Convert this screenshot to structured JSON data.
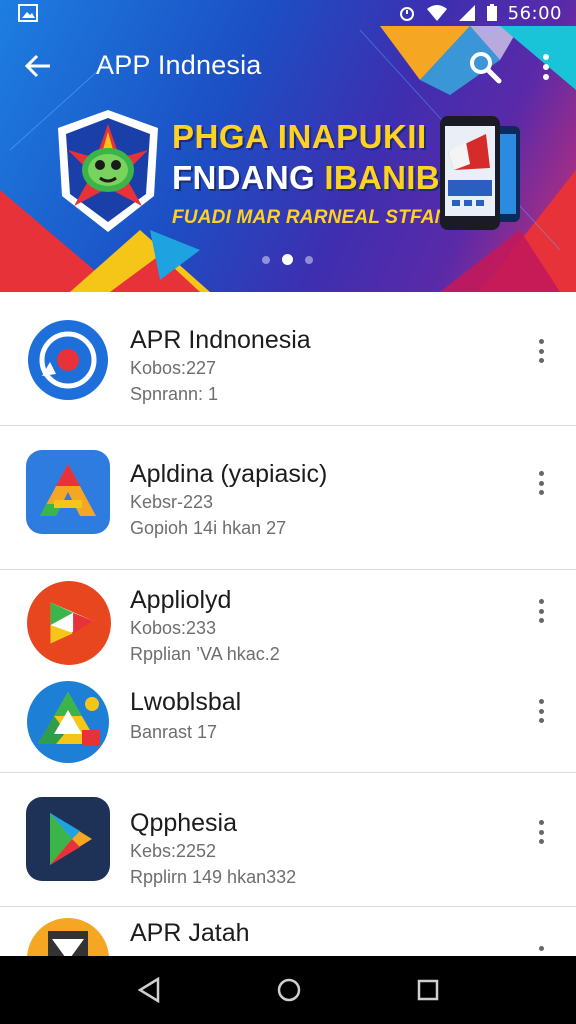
{
  "status_bar": {
    "time": "56:00",
    "icons": [
      "image-icon",
      "alarm-icon",
      "wifi-icon",
      "signal-icon",
      "battery-icon"
    ]
  },
  "app_bar": {
    "title": "APP Indnesia",
    "icons": [
      "back-arrow-icon",
      "search-icon",
      "more-vert-icon"
    ]
  },
  "banner": {
    "line1": "PHGA INAPUKII",
    "line2_white": "FNDANG ",
    "line2_yellow": "IBANIBA",
    "line3": "FUADI MAR RARNEAL STFAN",
    "slides": 3,
    "active_slide": 2
  },
  "apps": [
    {
      "name": "APR Indnonesia",
      "line1": "Kobos:227",
      "line2": "Spnrann: 1",
      "icon": "target-app-icon"
    },
    {
      "name": "Apldina (yapiasic)",
      "line1": "Kebsr-223",
      "line2": "Gopioh 14i hkan 27",
      "icon": "triangle-a-app-icon"
    },
    {
      "name": "Appliolyd",
      "line1": "Kobos:233",
      "line2": "Rpplian ’VA hkac.2",
      "icon": "play-triangle-app-icon"
    },
    {
      "name": "Lwoblsbal",
      "line1": "Banrast 17",
      "line2": "",
      "icon": "drive-app-icon"
    },
    {
      "name": "Qpphesia",
      "line1": "Kebs:2252",
      "line2": "Rpplirn 149 hkan332",
      "icon": "play-store-app-icon"
    },
    {
      "name": "APR Jatah",
      "line1": "",
      "line2": "",
      "icon": "box-app-icon"
    }
  ],
  "colors": {
    "status_bar": "#1b6fd0",
    "banner_yellow": "#ffd21f",
    "nav_bar": "#000000"
  },
  "nav_bar": {
    "icons": [
      "back-triangle-icon",
      "home-circle-icon",
      "recents-square-icon"
    ]
  }
}
